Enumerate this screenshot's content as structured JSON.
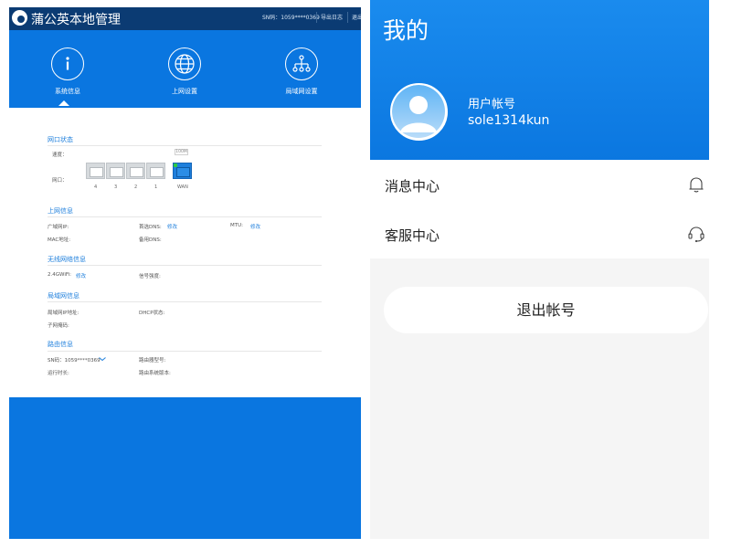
{
  "router": {
    "app_title": "蒲公英本地管理",
    "sn_top": "SN码：1059****0369",
    "export_log": "导出日志",
    "more": "退出",
    "nav": [
      {
        "label": "系统信息",
        "icon": "info-icon"
      },
      {
        "label": "上网设置",
        "icon": "globe-icon"
      },
      {
        "label": "局域网设置",
        "icon": "network-tree-icon"
      }
    ],
    "port_status": {
      "title": "网口状态",
      "speed_label": "速度：",
      "speed_value": "100M",
      "port_label": "网口：",
      "ports": [
        "4",
        "3",
        "2",
        "1"
      ],
      "wan_label": "WAN"
    },
    "internet": {
      "title": "上网信息",
      "wan_ip": "广域网IP:",
      "primary_dns": "首选DNS:",
      "primary_dns_edit": "修改",
      "mtu": "MTU:",
      "mtu_edit": "修改",
      "mac": "MAC地址:",
      "secondary_dns": "备用DNS:"
    },
    "wireless": {
      "title": "无线网络信息",
      "wifi": "2.4GWiFi:",
      "wifi_edit": "修改",
      "signal": "信号强度:"
    },
    "lan": {
      "title": "局域网信息",
      "lan_ip": "局域网IP地址:",
      "dhcp": "DHCP状态:",
      "subnet": "子网掩码:"
    },
    "device": {
      "title": "路由信息",
      "sn": "SN码：1059****0369",
      "model": "路由器型号:",
      "uptime": "运行时长:",
      "version": "路由系统版本:"
    }
  },
  "mobile": {
    "page_title": "我的",
    "user_label": "用户帐号",
    "user_name": "sole1314kun",
    "menu": [
      {
        "label": "消息中心",
        "icon": "bell-icon"
      },
      {
        "label": "客服中心",
        "icon": "headset-icon"
      }
    ],
    "logout_label": "退出帐号"
  }
}
